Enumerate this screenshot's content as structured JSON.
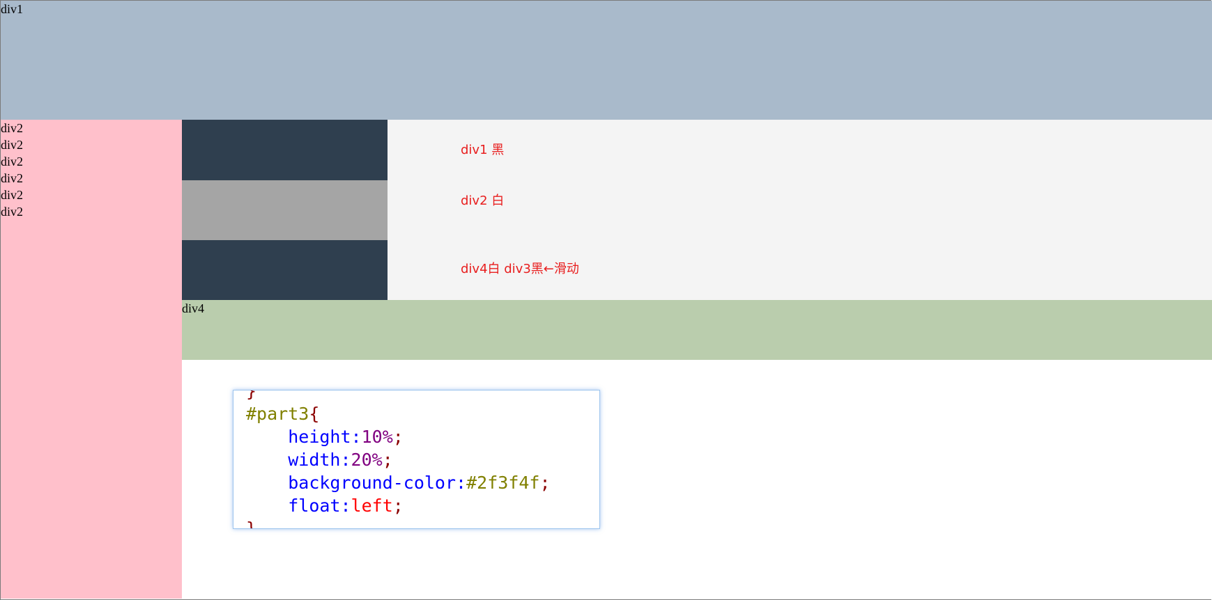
{
  "header": {
    "label": "div1"
  },
  "sidebar": {
    "lines": [
      "div2",
      "div2",
      "div2",
      "div2",
      "div2",
      "div2"
    ]
  },
  "stripes": {
    "notes": [
      "div1 黑",
      "div2 白",
      "div4白 div3黑←滑动"
    ],
    "colors": {
      "dark": "#2f3f4f",
      "grey": "#a5a5a5",
      "background": "#f4f4f4"
    }
  },
  "footer_band": {
    "label": "div4"
  },
  "code_snippet": {
    "top_fragment": "}",
    "selector": "#part3",
    "open_brace": "{",
    "close_brace": "}",
    "declarations": [
      {
        "property": "height",
        "value": "10%"
      },
      {
        "property": "width",
        "value": "20%"
      },
      {
        "property": "background-color",
        "value": "#2f3f4f"
      },
      {
        "property": "float",
        "value": "left"
      }
    ]
  },
  "palette": {
    "header_bg": "#a9bacb",
    "sidebar_bg": "#ffc0cb",
    "band_bg": "#bacdad",
    "note_text": "#e81e1e"
  }
}
